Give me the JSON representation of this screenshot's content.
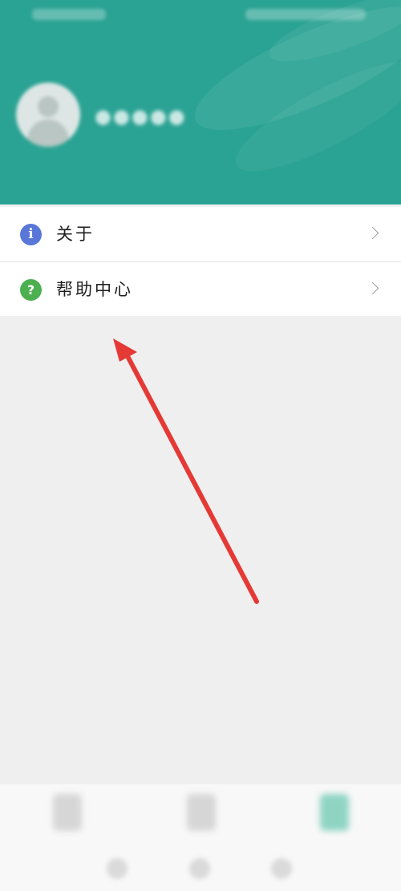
{
  "menu": {
    "items": [
      {
        "label": "关于",
        "icon": "info-icon",
        "color": "#5877d8"
      },
      {
        "label": "帮助中心",
        "icon": "help-icon",
        "color": "#4caf50"
      }
    ]
  },
  "icons": {
    "info_glyph": "i",
    "help_glyph": "?"
  },
  "colors": {
    "header_bg": "#2ba394",
    "page_bg": "#efefef",
    "arrow": "#e53935"
  }
}
